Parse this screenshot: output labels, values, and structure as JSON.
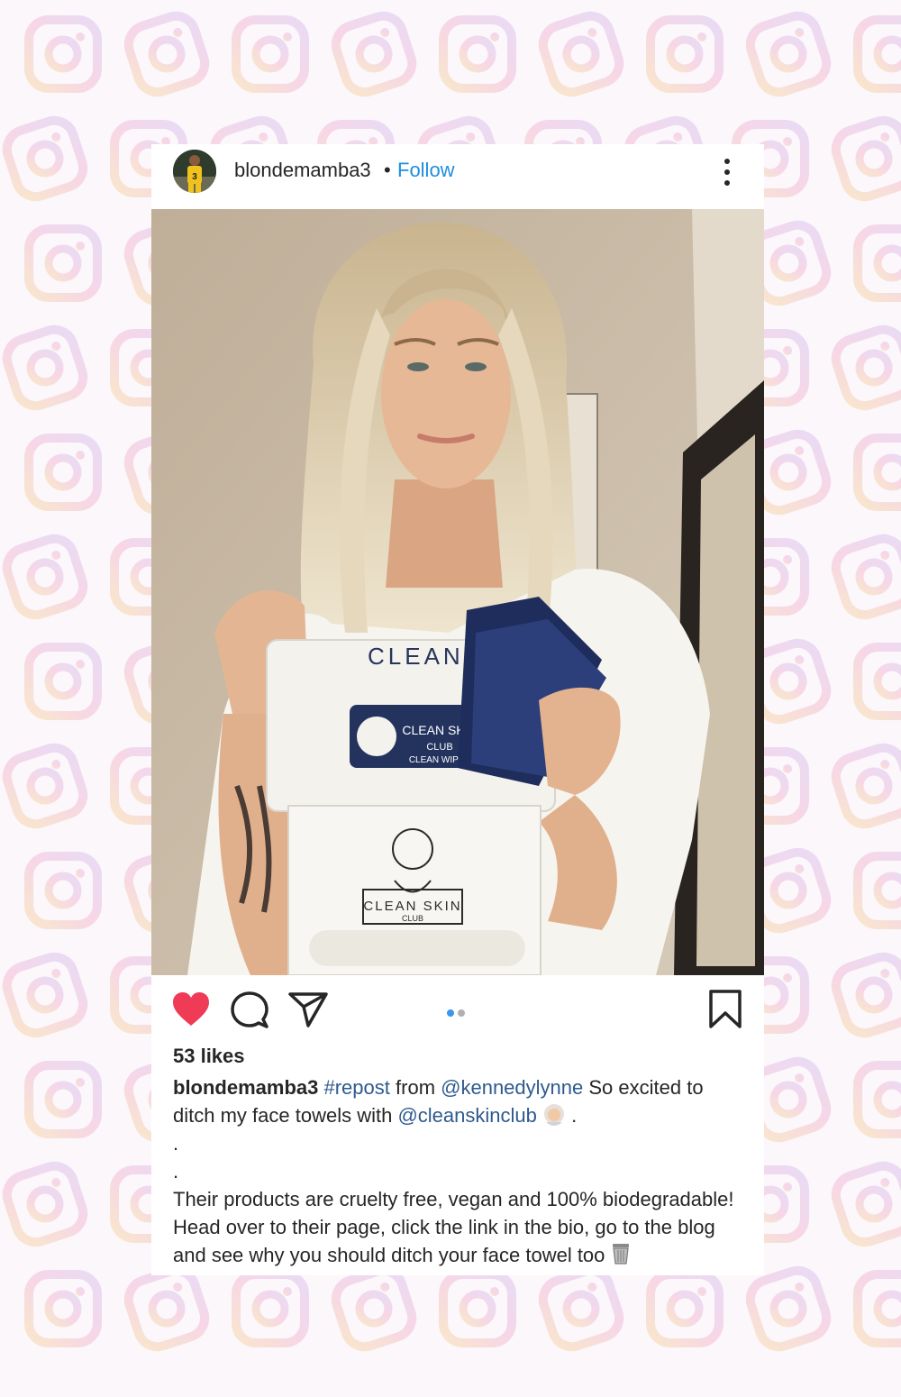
{
  "colors": {
    "background": "#fbf7fb",
    "card": "#ffffff",
    "follow_blue": "#1e8ee0",
    "hashtag_blue": "#2e5a8e",
    "like_red": "#ef3b55",
    "pager_active": "#3897f0",
    "pager_inactive": "#b0b0b0"
  },
  "background": {
    "pattern_icon": "instagram-logo-icon"
  },
  "post": {
    "header": {
      "username": "blondemamba3",
      "separator": "•",
      "follow_label": "Follow",
      "avatar_icon": "avatar-basketball-player",
      "more_icon": "more-vertical-icon"
    },
    "photo": {
      "description_icon": "photo-woman-holding-clean-skin-club-products",
      "product_texts": [
        "CLEAN SKIN",
        "CLUB",
        "CLEAN WIPES"
      ]
    },
    "actions": {
      "liked": true,
      "icons": [
        "heart-icon",
        "comment-icon",
        "share-icon",
        "bookmark-icon"
      ],
      "pager": {
        "count": 2,
        "active_index": 0
      }
    },
    "likes": "53 likes",
    "caption": {
      "username": "blondemamba3",
      "hashtag": "#repost",
      "text_1": "from",
      "mention_1": "@kennedylynne",
      "text_2": "So excited to ditch my face towels with",
      "mention_2": "@cleanskinclub",
      "emoji_1": "woman-with-headscarf-emoji",
      "text_3": ".",
      "dot_1": ".",
      "dot_2": ".",
      "body_1": "Their products are cruelty free, vegan and 100% biodegradable!",
      "body_2": "Head over to their page, click the link in the bio, go to the blog",
      "body_3": "and see why you should ditch your face towel too",
      "emoji_2": "wastebasket-emoji"
    }
  }
}
